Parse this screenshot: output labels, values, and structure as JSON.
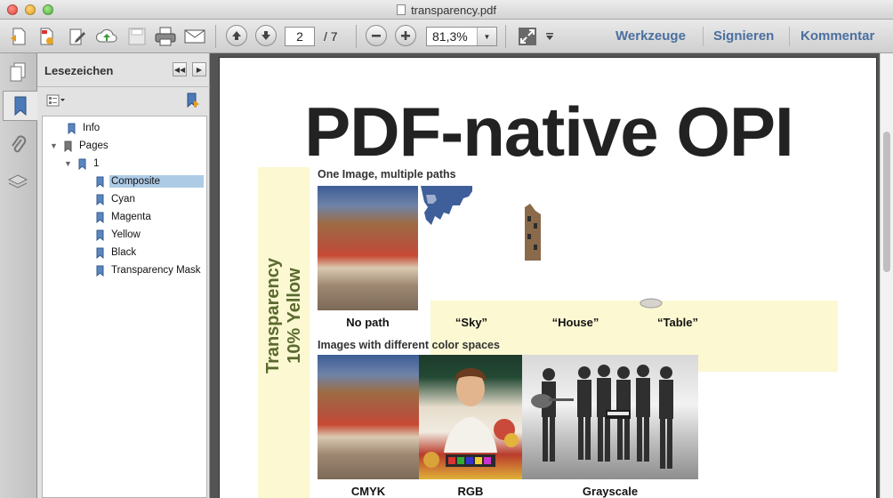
{
  "window": {
    "title": "transparency.pdf"
  },
  "toolbar": {
    "page_current": "2",
    "page_total": "/ 7",
    "zoom": "81,3%",
    "links": [
      "Werkzeuge",
      "Signieren",
      "Kommentar"
    ]
  },
  "sidebar": {
    "title": "Lesezeichen",
    "bookmarks": [
      {
        "label": "Info"
      },
      {
        "label": "Pages"
      },
      {
        "label": "1"
      },
      {
        "label": "Composite",
        "selected": true
      },
      {
        "label": "Cyan"
      },
      {
        "label": "Magenta"
      },
      {
        "label": "Yellow"
      },
      {
        "label": "Black"
      },
      {
        "label": "Transparency Mask"
      }
    ]
  },
  "document": {
    "title": "PDF-native OPI",
    "side_label_line1": "Transparency",
    "side_label_line2": "10% Yellow",
    "section1": "One Image, multiple paths",
    "captions1": [
      "No path",
      "“Sky”",
      "“House”",
      "“Table”"
    ],
    "section2": "Images with different color spaces",
    "captions2": [
      "CMYK",
      "RGB",
      "Grayscale"
    ]
  },
  "colors": {
    "accent_link": "#4a6fa0",
    "selection": "#aecbe6",
    "pale_yellow": "#fbf8d2",
    "side_label_text": "#5a6a2e"
  }
}
